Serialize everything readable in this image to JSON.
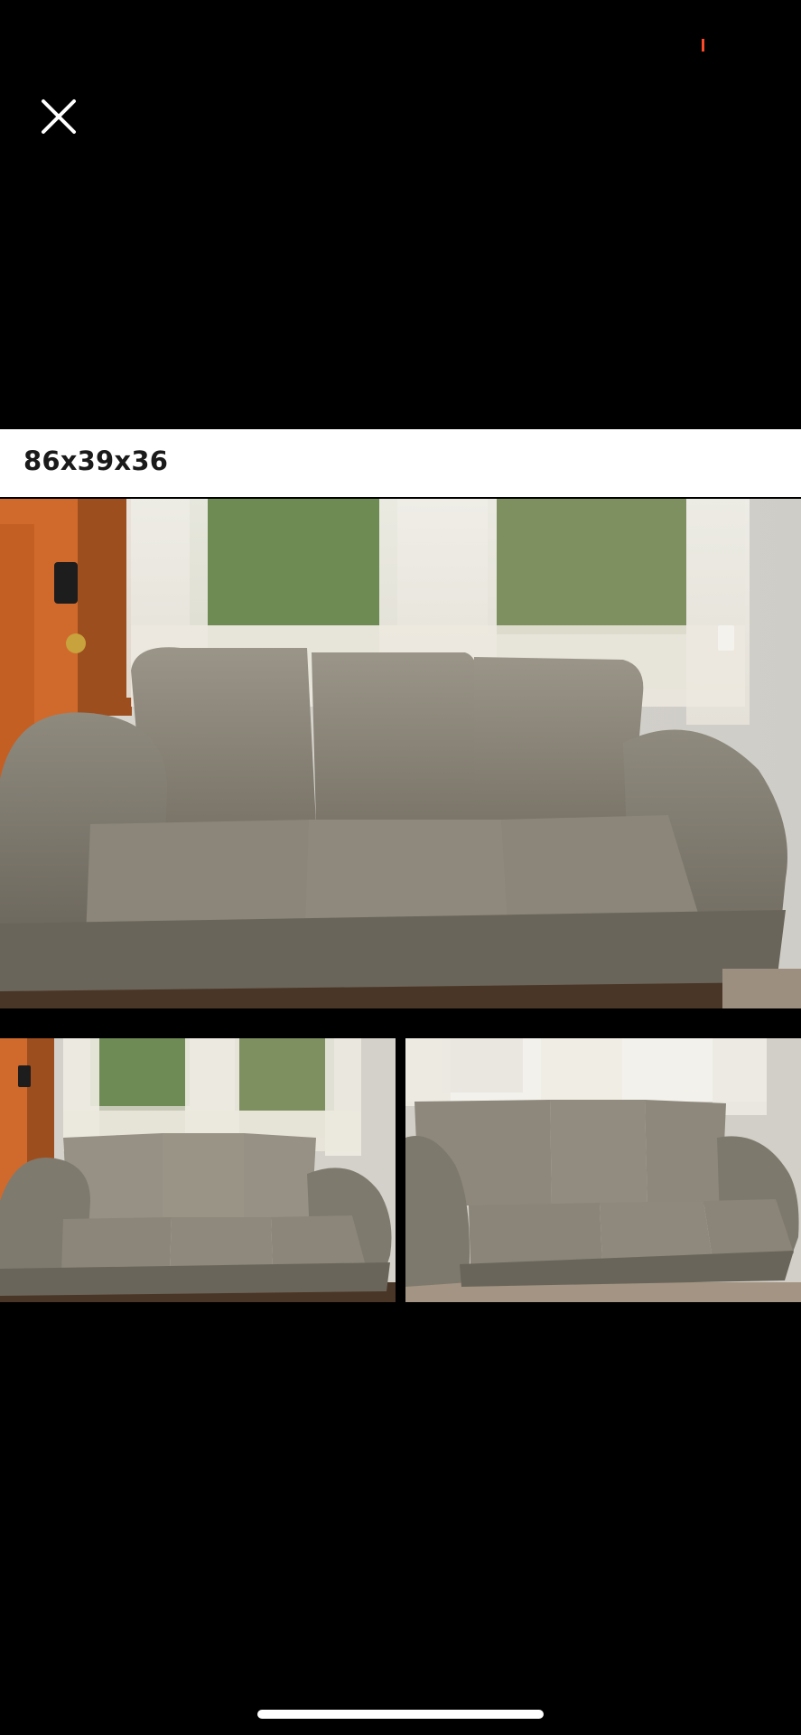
{
  "viewer": {
    "close_icon": "close-icon",
    "post": {
      "caption": "86x39x36"
    },
    "photos": [
      {
        "subject": "sofa-photo-front"
      },
      {
        "subject": "sofa-photo-wide"
      },
      {
        "subject": "sofa-photo-angle"
      }
    ]
  },
  "colors": {
    "background": "#000000",
    "caption_background": "#ffffff",
    "caption_text": "#1a1a1a",
    "status_accent": "#ff4a2a"
  }
}
